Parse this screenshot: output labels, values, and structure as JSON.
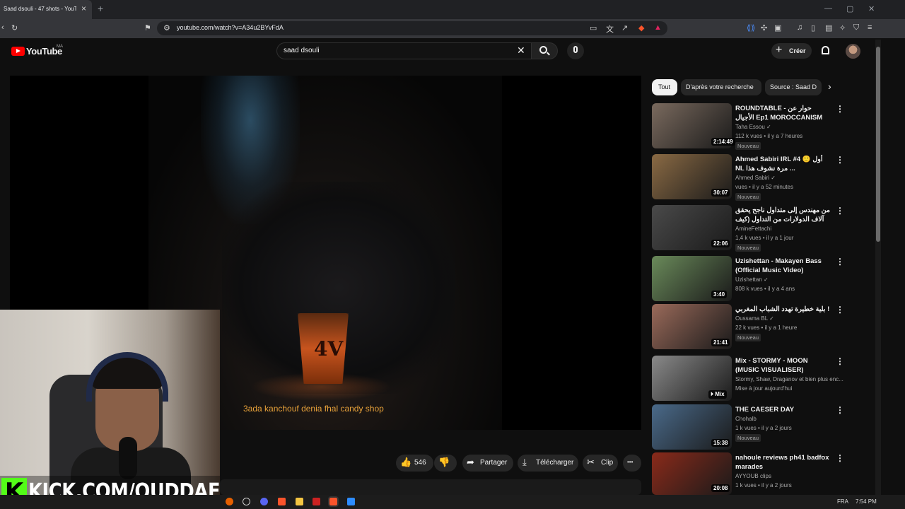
{
  "browser": {
    "tab_title": "Saad dsouli - 47 shots - YouT",
    "tab_close": "×",
    "new_tab": "+",
    "url": "youtube.com/watch?v=A34u2BYvFdA",
    "win_min": "—",
    "win_max": "▢",
    "win_close": "✕"
  },
  "header": {
    "logo_text": "YouTube",
    "country": "MA",
    "search_value": "saad dsouli",
    "clear": "✕",
    "create_label": "Créer",
    "create_plus": "+"
  },
  "video": {
    "subtitle": "3ada kanchouf denia fhal candy shop",
    "glass_text": "4V"
  },
  "overlay": {
    "kick_logo": "K",
    "kick_text": "KICK.COM/OUDDAFI"
  },
  "actions": {
    "likes": "546",
    "like_icon": "👍",
    "dislike_icon": "👎",
    "share_label": "Partager",
    "share_icon": "➦",
    "download_label": "Télécharger",
    "download_icon": "⤓",
    "clip_label": "Clip",
    "clip_icon": "✂",
    "more_icon": "•••"
  },
  "chips": [
    "Tout",
    "D'après votre recherche",
    "Source : Saad D",
    "›"
  ],
  "recommendations": [
    {
      "title": "ROUNDTABLE - حوار عن الأجيال Ep1 MOROCCANISM",
      "channel": "Taha Essou ✓",
      "meta": "112 k vues • il y a 7 heures",
      "badge": "Nouveau",
      "duration": "2:14:49",
      "thumb_color": "#7a6a5e"
    },
    {
      "title": "Ahmed Sabiri IRL #4 🙂 أول NL مرة نشوف هذا ...",
      "channel": "Ahmed Sabiri ✓",
      "meta": "vues • il y a 52 minutes",
      "badge": "Nouveau",
      "duration": "30:07",
      "thumb_color": "#8a6a44"
    },
    {
      "title": "من مهندس إلى متداول ناجح يحقق آلاف الدولارات من التداول (كيف تعلم التداول) ...",
      "channel": "AmineFettachi",
      "meta": "1,4 k vues • il y a 1 jour",
      "badge": "Nouveau",
      "duration": "22:06",
      "thumb_color": "#4a4a4a"
    },
    {
      "title": "Uzishettan - Makayen Bass (Official Music Video)",
      "channel": "Uzishettan ✓",
      "meta": "808 k vues • il y a 4 ans",
      "badge": "",
      "duration": "3:40",
      "thumb_color": "#6a8a5a"
    },
    {
      "title": "بلية خطيرة تهدد الشباب المغربي !",
      "channel": "Oussama BL ✓",
      "meta": "22 k vues • il y a 1 heure",
      "badge": "Nouveau",
      "duration": "21:41",
      "thumb_color": "#9a6a5a"
    },
    {
      "title": "Mix - STORMY - MOON (MUSIC VISUALISER)",
      "channel": "Stormy, Shaw, Draganov et bien plus enc...",
      "meta": "Mise à jour aujourd'hui",
      "badge": "",
      "duration": "⏵ Mix",
      "thumb_color": "#8a8a8a"
    },
    {
      "title": "THE CAESER DAY",
      "channel": "Chohalb",
      "meta": "1 k vues • il y a 2 jours",
      "badge": "Nouveau",
      "duration": "15:38",
      "thumb_color": "#4a6a8a"
    },
    {
      "title": "nahoule reviews ph41 badfox marades",
      "channel": "AYYOUB clips",
      "meta": "1 k vues • il y a 2 jours",
      "badge": "",
      "duration": "20:08",
      "thumb_color": "#8a2a1a"
    }
  ],
  "taskbar": {
    "lang": "FRA",
    "time": "7:54 PM"
  }
}
